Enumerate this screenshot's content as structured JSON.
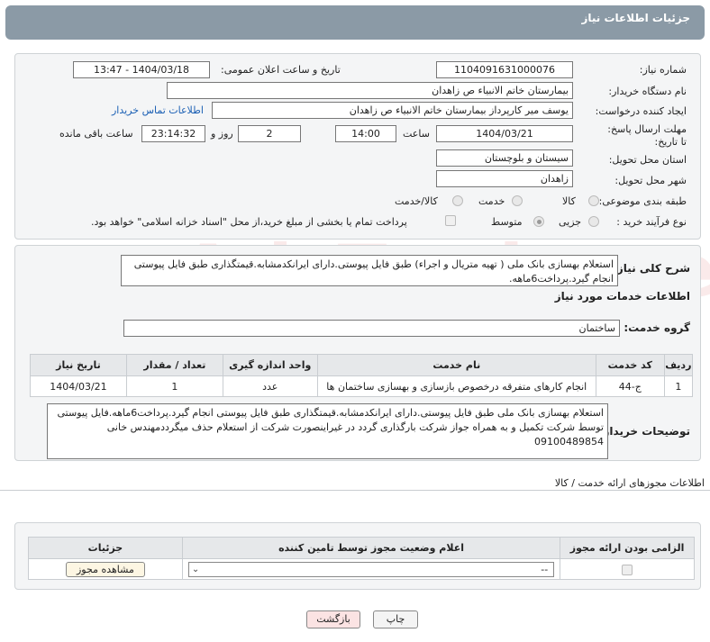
{
  "header": {
    "title": "جزئیات اطلاعات نیاز"
  },
  "form": {
    "need_number_label": "شماره نیاز:",
    "need_number": "1104091631000076",
    "announce_label": "تاریخ و ساعت اعلان عمومی:",
    "announce_value": "1404/03/18 - 13:47",
    "buyer_org_label": "نام دستگاه خریدار:",
    "buyer_org": "بیمارستان خاتم الانبیاء  ص  زاهدان",
    "creator_label": "ایجاد کننده درخواست:",
    "creator": "یوسف میر کارپرداز بیمارستان خاتم الانبیاء  ص  زاهدان",
    "contact_link": "اطلاعات تماس خریدار",
    "deadline_label": "مهلت ارسال پاسخ: تا تاریخ:",
    "deadline_date": "1404/03/21",
    "time_label": "ساعت",
    "deadline_time": "14:00",
    "days_value": "2",
    "days_label": "روز و",
    "remaining_time": "23:14:32",
    "remaining_label": "ساعت باقی مانده",
    "province_label": "استان محل تحویل:",
    "province": "سیستان و بلوچستان",
    "city_label": "شهر محل تحویل:",
    "city": "زاهدان",
    "category_label": "طبقه بندی موضوعی:",
    "category_options": [
      "کالا",
      "خدمت",
      "کالا/خدمت"
    ],
    "purchase_type_label": "نوع فرآیند خرید :",
    "purchase_options": [
      "جزیی",
      "متوسط"
    ],
    "payment_note": "پرداخت تمام یا بخشی از مبلغ خرید،از محل \"اسناد خزانه اسلامی\" خواهد بود."
  },
  "summary": {
    "label": "شرح کلی نیاز:",
    "text": "استعلام بهسازی بانک ملی ( تهیه متریال و اجراء) طبق فایل پیوستی.دارای ایرانکدمشابه.قیمتگذاری طبق فایل پیوستی انجام گیرد.پرداخت6ماهه."
  },
  "services": {
    "section_title": "اطلاعات خدمات مورد نیاز",
    "group_label": "گروه خدمت:",
    "group_value": "ساختمان",
    "columns": [
      "ردیف",
      "کد خدمت",
      "نام خدمت",
      "واحد اندازه گیری",
      "تعداد / مقدار",
      "تاریخ نیاز"
    ],
    "rows": [
      {
        "row": "1",
        "code": "ج-44",
        "name": "انجام کارهای متفرقه درخصوص بازسازی و بهسازی ساختمان ها",
        "unit": "عدد",
        "qty": "1",
        "date": "1404/03/21"
      }
    ]
  },
  "buyer_notes": {
    "label": "توضیحات خریدار:",
    "text": "استعلام بهسازی بانک ملی طبق فایل پیوستی.دارای ایرانکدمشابه.قیمتگذاری طبق فایل پیوستی انجام گیرد.پرداخت6ماهه.فایل پیوستی توسط شرکت تکمیل و به همراه جواز شرکت بارگذاری گردد در غیراینصورت شرکت از استعلام حذف میگرددمهندس خانی 09100489854"
  },
  "permits": {
    "section_title": "اطلاعات مجوزهای ارائه خدمت / کالا",
    "columns": [
      "الزامی بودن ارائه مجوز",
      "اعلام وضعیت مجوز توسط تامین کننده",
      "جزئیات"
    ],
    "select_value": "--",
    "view_button": "مشاهده مجوز"
  },
  "footer": {
    "print_button": "چاپ",
    "back_button": "بازگشت"
  },
  "watermark": "AriaTender.neT"
}
